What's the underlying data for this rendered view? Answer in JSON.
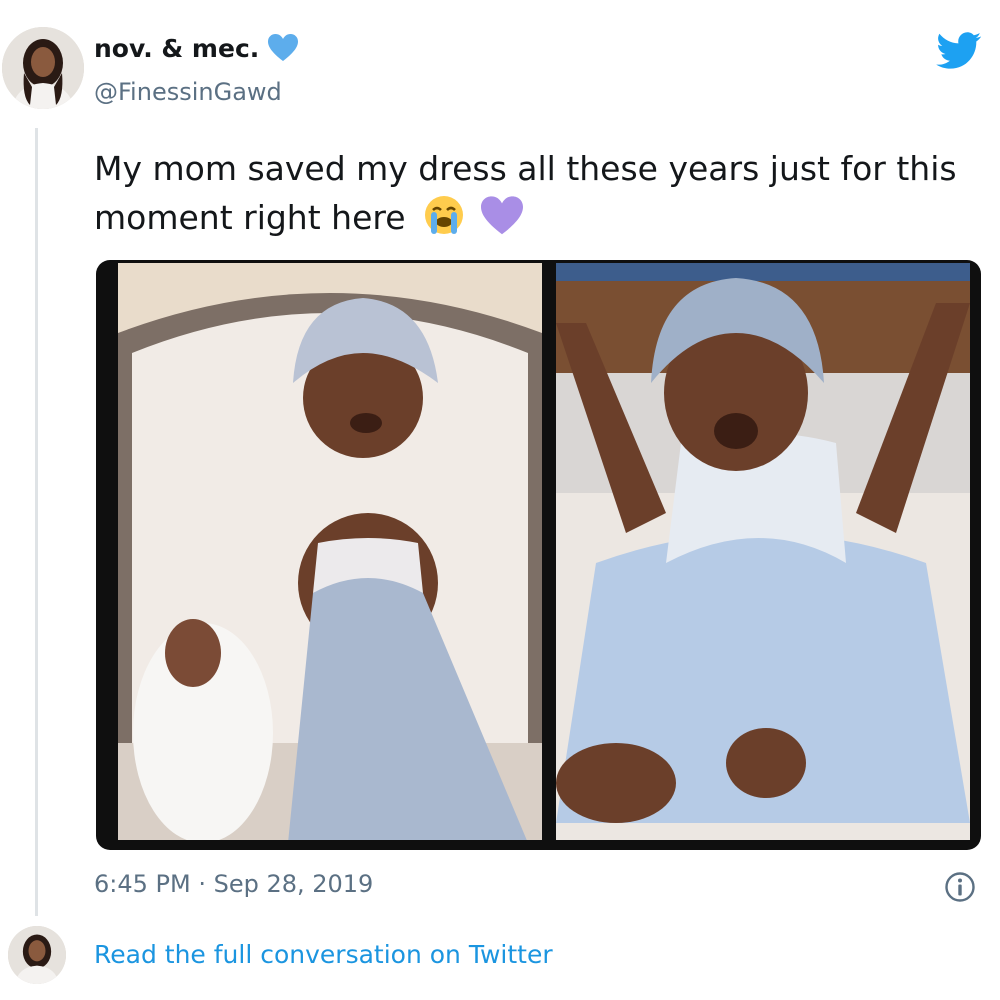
{
  "author": {
    "display_name": "nov. & mec.",
    "handle": "@FinessinGawd",
    "verified_emoji": "blue-heart-icon",
    "avatar": "profile-avatar"
  },
  "tweet": {
    "text": "My mom saved my dress all these years just for this moment right here",
    "emojis": [
      "loudly-crying-face-icon",
      "purple-heart-icon"
    ],
    "timestamp": "6:45 PM · Sep 28, 2019",
    "media": [
      "baby-photo-old-portrait",
      "baby-photo-recent-on-bed"
    ]
  },
  "footer": {
    "read_more": "Read the full conversation on Twitter"
  },
  "icons": {
    "brand": "twitter-bird-icon",
    "info": "info-icon"
  },
  "colors": {
    "link": "#1b95e0",
    "secondary_text": "#5b7083",
    "twitter_blue": "#1da1f2",
    "purple_heart": "#a98ee6"
  }
}
